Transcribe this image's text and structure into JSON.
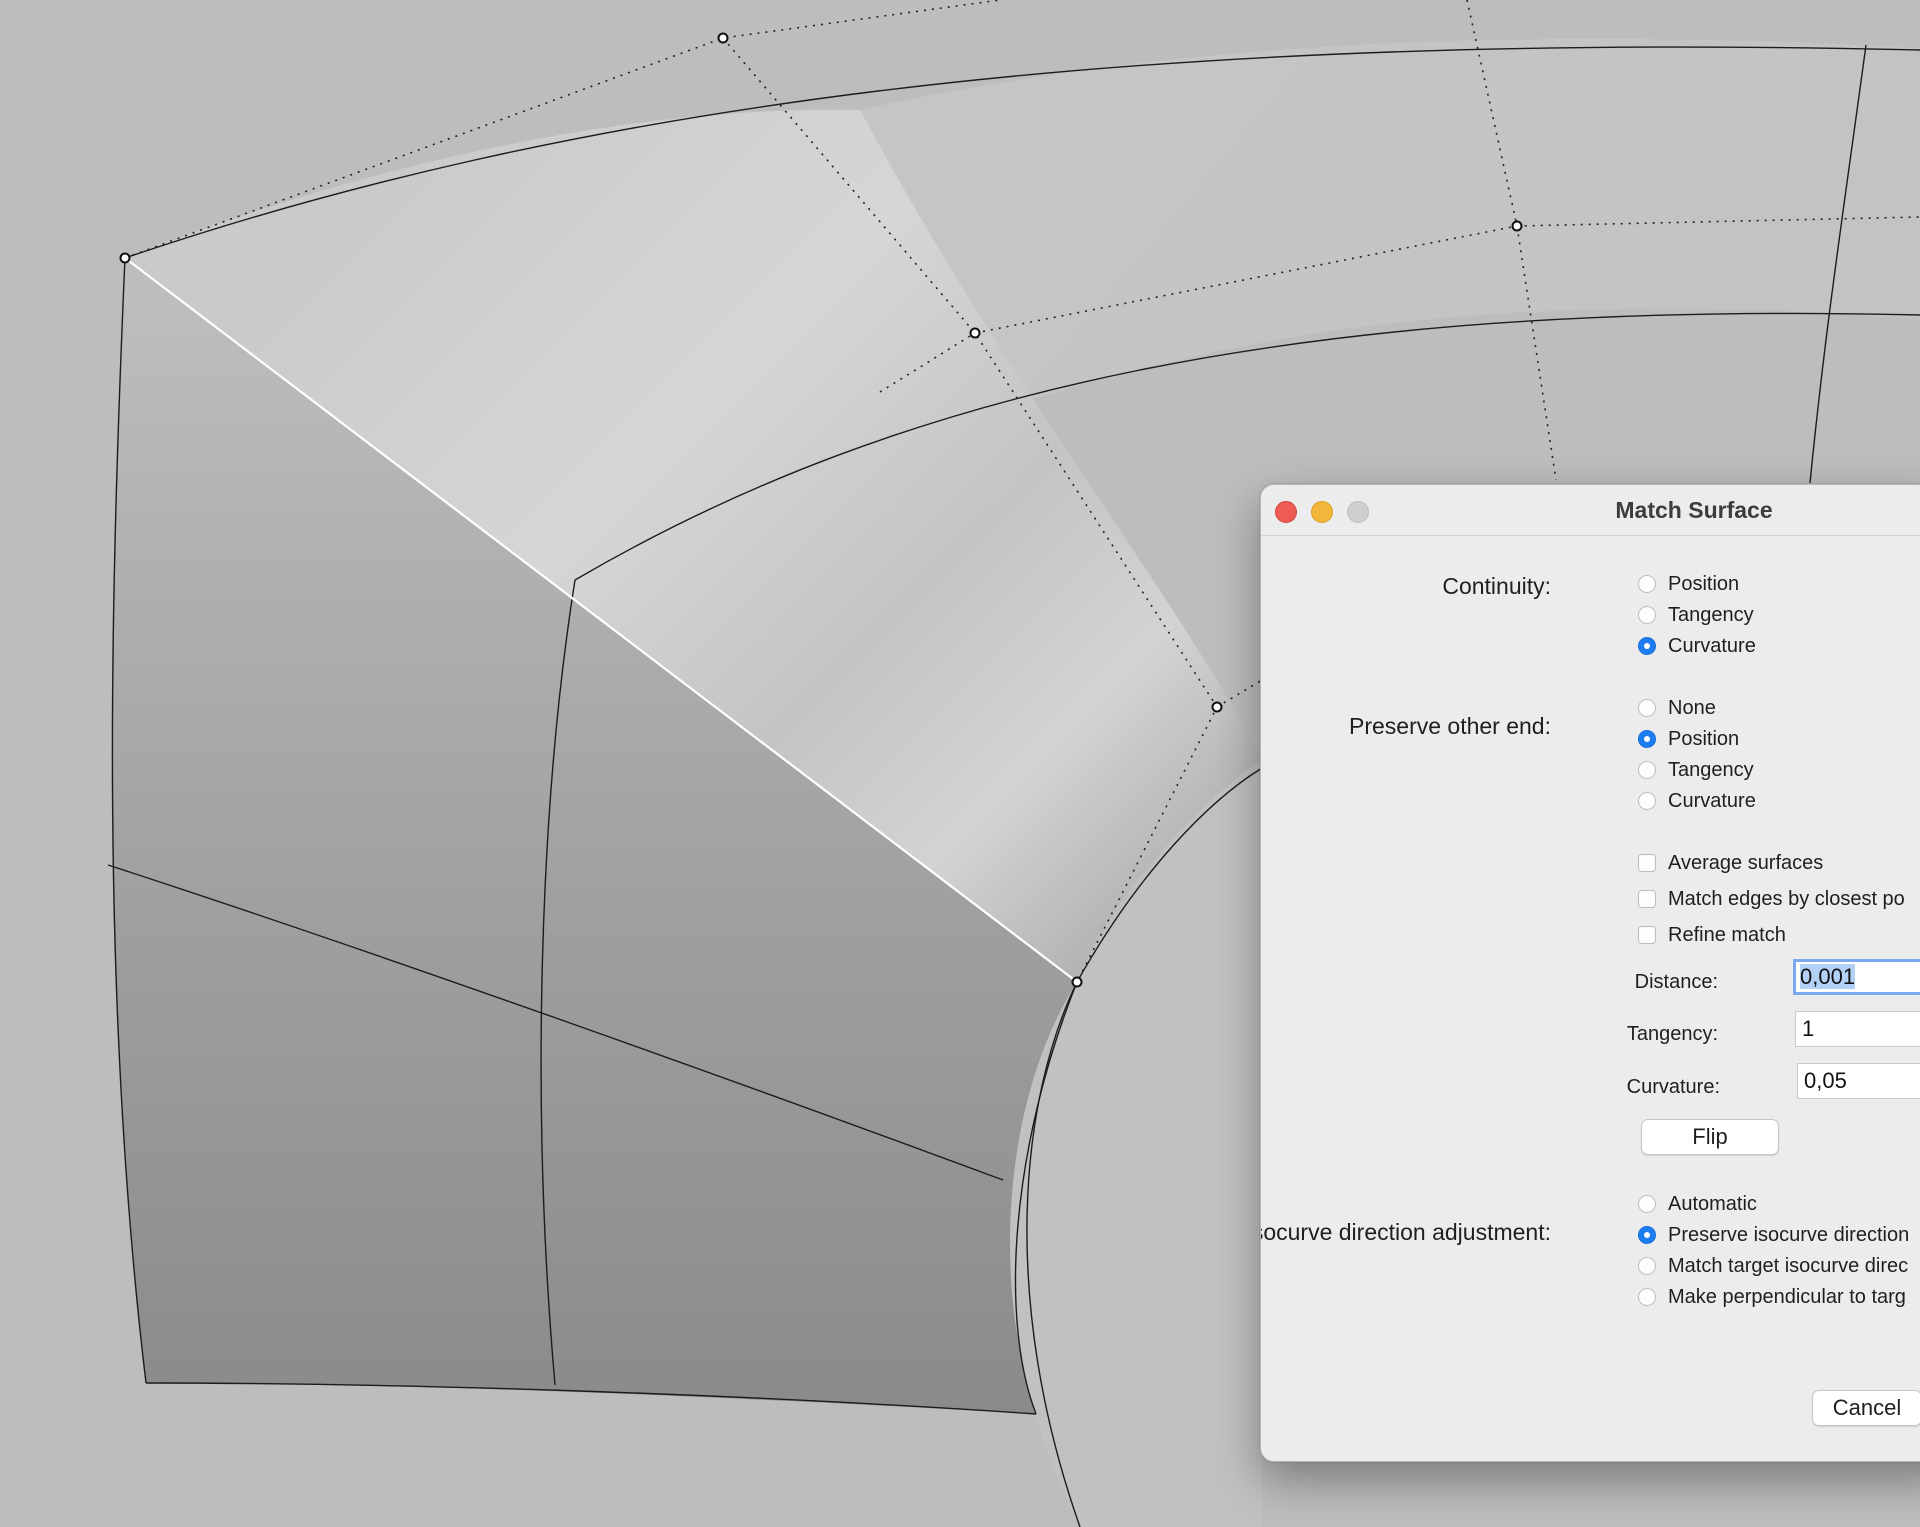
{
  "dialog": {
    "title": "Match Surface",
    "continuity": {
      "label": "Continuity:",
      "options": [
        "Position",
        "Tangency",
        "Curvature"
      ],
      "selected": "Curvature"
    },
    "preserve_other_end": {
      "label": "Preserve other end:",
      "options": [
        "None",
        "Position",
        "Tangency",
        "Curvature"
      ],
      "selected": "Position"
    },
    "checkboxes": {
      "average_surfaces": {
        "label": "Average surfaces",
        "checked": false
      },
      "match_edges": {
        "label": "Match edges by closest po",
        "checked": false
      },
      "refine_match": {
        "label": "Refine match",
        "checked": false
      }
    },
    "distance": {
      "label": "Distance:",
      "value": "0,001"
    },
    "tangency": {
      "label": "Tangency:",
      "value": "1"
    },
    "curvature": {
      "label": "Curvature:",
      "value": "0,05"
    },
    "flip_button": "Flip",
    "isocurve": {
      "label": "Isocurve direction adjustment:",
      "options": [
        "Automatic",
        "Preserve isocurve direction",
        "Match target isocurve direc",
        "Make perpendicular to targ"
      ],
      "selected": "Preserve isocurve direction"
    },
    "cancel_button": "Cancel"
  },
  "colors": {
    "radio_selected": "#1e7cf2",
    "close": "#ee5b55",
    "minimize": "#f2b63a",
    "zoom_disabled": "#cfcfcf",
    "canvas_background": "#bdbdbd"
  }
}
